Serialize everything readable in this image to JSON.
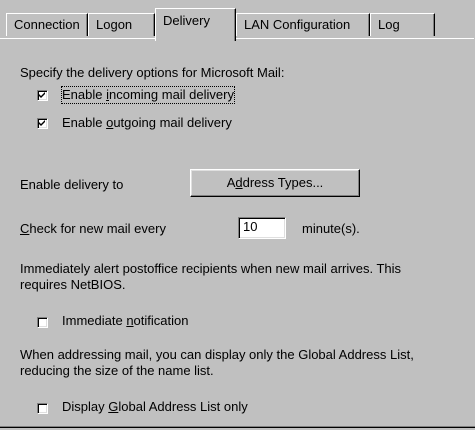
{
  "tabs": [
    {
      "label": "Connection"
    },
    {
      "label": "Logon"
    },
    {
      "label": "Delivery",
      "selected": true
    },
    {
      "label": "LAN Configuration"
    },
    {
      "label": "Log"
    }
  ],
  "delivery": {
    "intro": "Specify the delivery options for Microsoft Mail:",
    "incoming": {
      "pre": "Enable ",
      "accel": "i",
      "post": "ncoming mail delivery",
      "checked": true
    },
    "outgoing": {
      "pre": "Enable ",
      "accel": "o",
      "post": "utgoing mail delivery",
      "checked": true
    },
    "enable_delivery_to": "Enable delivery to",
    "address_types_button": {
      "pre": "A",
      "accel": "d",
      "post": "dress Types..."
    },
    "check_label": {
      "accel": "C",
      "post": "heck for new mail every"
    },
    "check_value": "10",
    "check_units": "minute(s).",
    "alert_text_1": "Immediately alert postoffice recipients when new mail arrives.  This",
    "alert_text_2": "requires NetBIOS.",
    "immediate": {
      "pre": "Immediate ",
      "accel": "n",
      "post": "otification",
      "checked": false
    },
    "gal_text_1": "When addressing mail, you can display only the Global Address List,",
    "gal_text_2": "reducing the size of the name list.",
    "gal_only": {
      "pre": "Display ",
      "accel": "G",
      "post": "lobal Address List only",
      "checked": false
    }
  }
}
